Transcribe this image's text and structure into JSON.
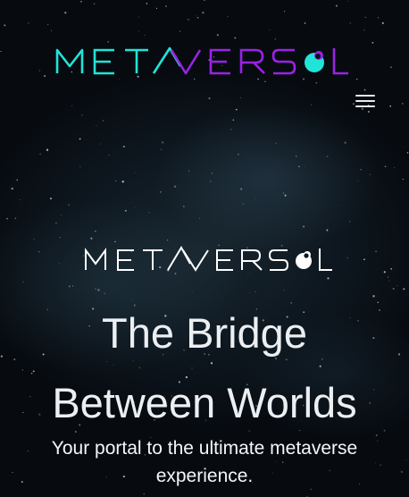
{
  "header": {
    "logo": {
      "part1": "META",
      "part2": "VERS",
      "part3": "L",
      "accent_cyan": "#22e3d8",
      "accent_purple": "#9a22e6",
      "icon": "metaverse-logo-icon"
    },
    "menu_icon": "hamburger-menu-icon"
  },
  "hero": {
    "logo": {
      "part1": "META",
      "part2": "VERS",
      "part3": "L",
      "color": "#ffffff"
    },
    "title_line1": "The Bridge",
    "title_line2": "Between Worlds",
    "subtitle_line1": "Your portal to the ultimate metaverse",
    "subtitle_line2": "experience."
  },
  "background": {
    "style": "starfield-nebula",
    "color": "#0a1018"
  }
}
